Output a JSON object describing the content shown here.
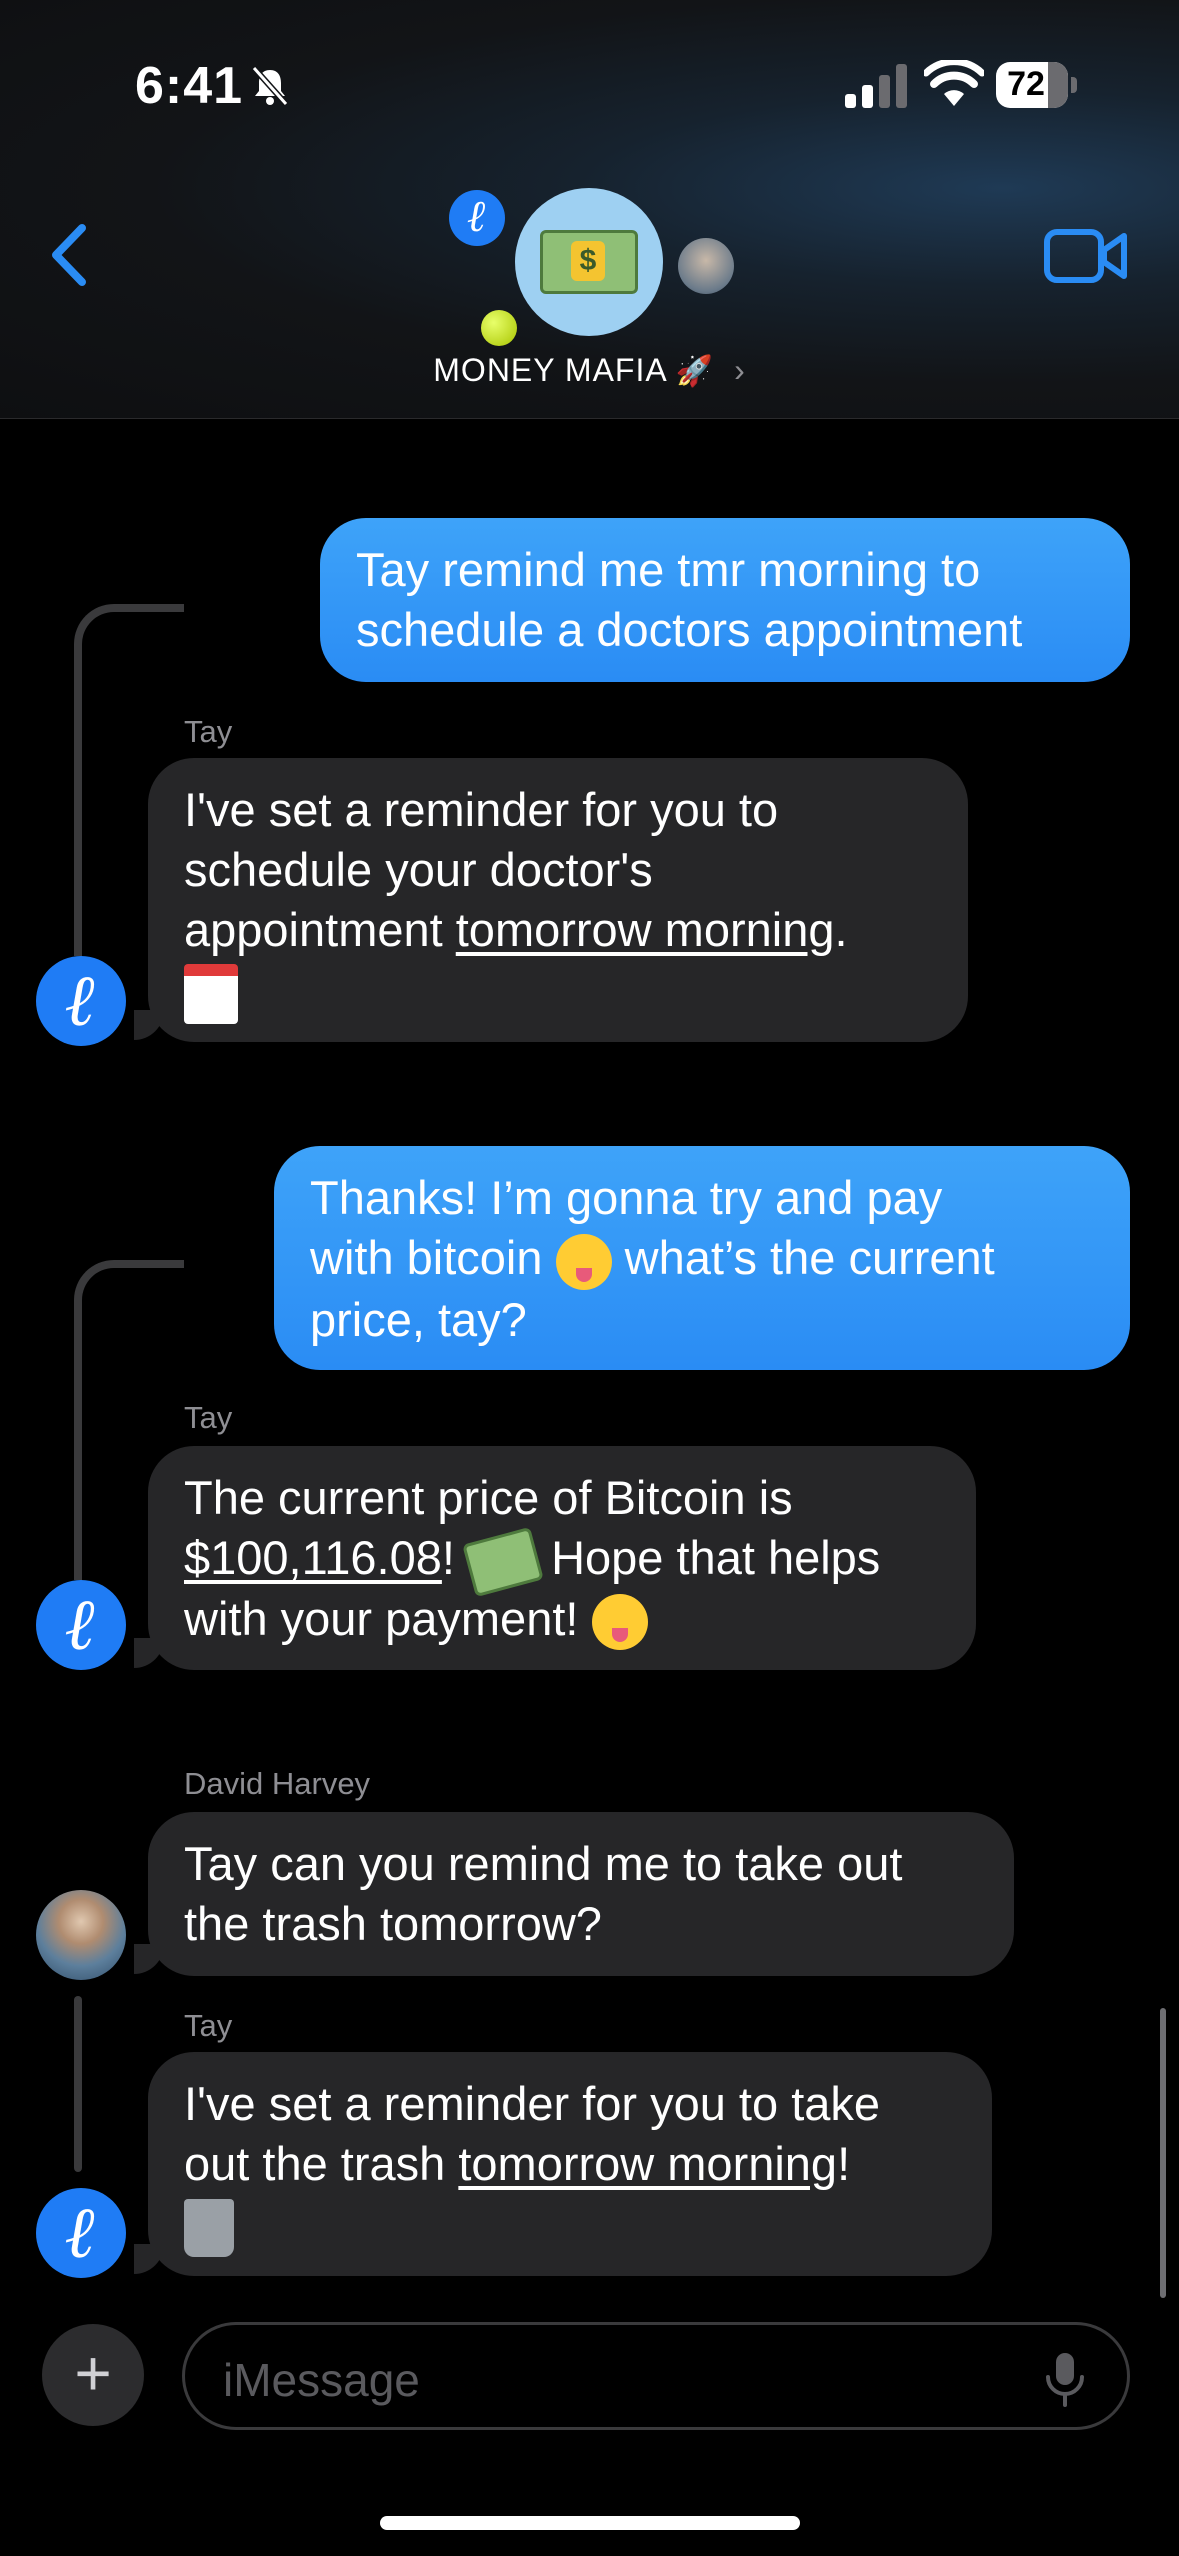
{
  "status_bar": {
    "time": "6:41",
    "battery": "72",
    "icons": [
      "bell-slash-icon",
      "cellular-signal-icon",
      "wifi-icon",
      "battery-icon"
    ]
  },
  "header": {
    "group_name": "MONEY MAFIA",
    "group_emoji": "🚀",
    "chevron": "›",
    "icons": [
      "back-chevron-icon",
      "video-camera-icon"
    ]
  },
  "messages": [
    {
      "type": "outgoing",
      "text": "Tay remind me tmr morning to\nschedule a doctors appointment"
    },
    {
      "type": "incoming",
      "sender": "Tay",
      "text_before": "I've set a reminder for you to\nschedule your doctor's\nappointment ",
      "link": "tomorrow morning",
      "text_after": ".",
      "emoji": "calendar-emoji"
    },
    {
      "type": "outgoing",
      "line1": "Thanks! I’m gonna try and pay",
      "line2_a": "with bitcoin ",
      "line2_b": " what’s the current",
      "line3": "price, tay?"
    },
    {
      "type": "incoming",
      "sender": "Tay",
      "line1": "The current price of Bitcoin is",
      "link": "$100,116.08",
      "line2_after": "! ",
      "line2_end": " Hope that helps",
      "line3": "with your payment! "
    },
    {
      "type": "incoming",
      "sender": "David Harvey",
      "text": "Tay can you remind me to take out\nthe trash tomorrow?"
    },
    {
      "type": "incoming",
      "sender": "Tay",
      "text_before": "I've set a reminder for you to take\nout the trash ",
      "link": "tomorrow morning",
      "text_after": "!",
      "emoji": "wastebasket-emoji"
    }
  ],
  "composer": {
    "plus": "+",
    "placeholder": "iMessage"
  }
}
